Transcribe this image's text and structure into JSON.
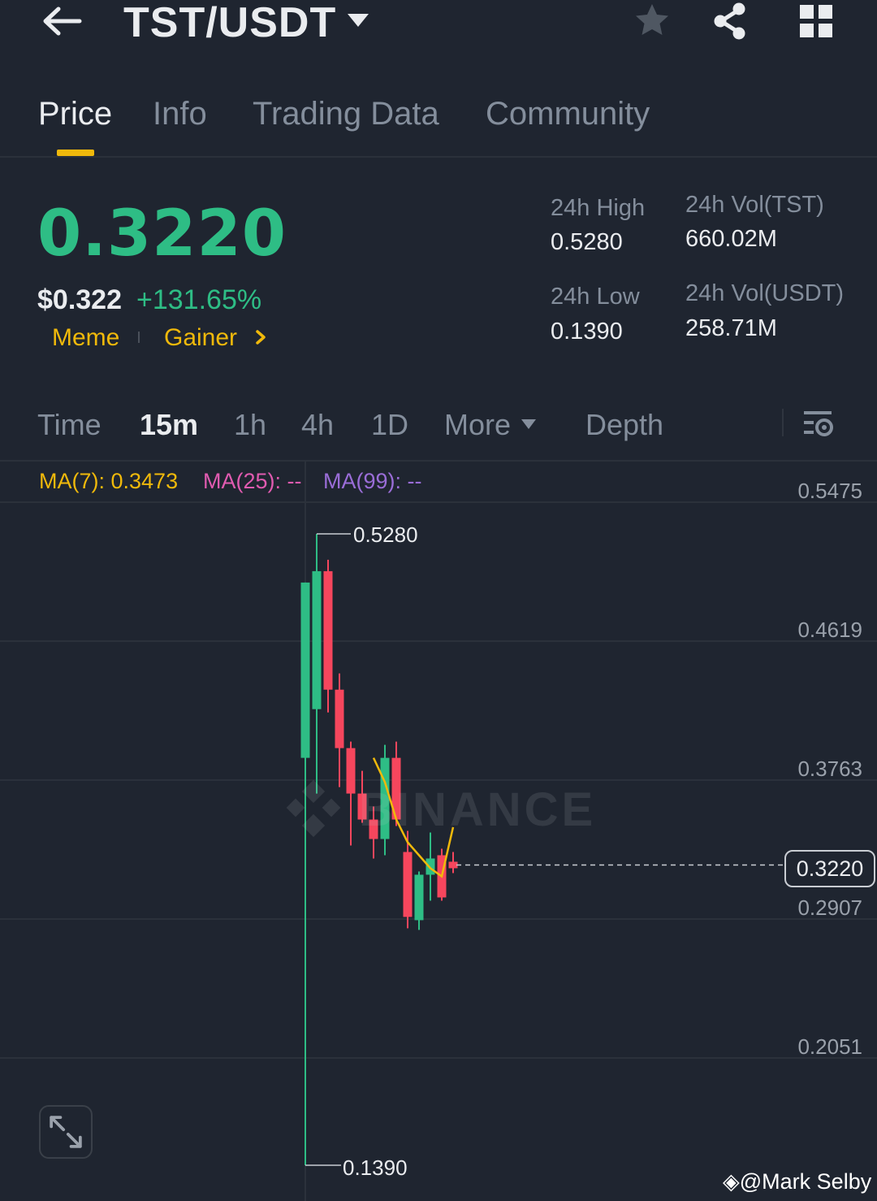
{
  "header": {
    "pair": "TST/USDT",
    "icons": [
      "back-arrow-icon",
      "caret-down-icon",
      "star-icon",
      "share-icon",
      "grid-icon"
    ]
  },
  "tabs": [
    {
      "label": "Price",
      "active": true
    },
    {
      "label": "Info",
      "active": false
    },
    {
      "label": "Trading Data",
      "active": false
    },
    {
      "label": "Community",
      "active": false
    }
  ],
  "ticker": {
    "last_price": "0.3220",
    "usd_price": "$0.322",
    "change_pct": "+131.65%",
    "tags": [
      "Meme",
      "Gainer"
    ],
    "stats": {
      "high_label": "24h High",
      "high_value": "0.5280",
      "low_label": "24h Low",
      "low_value": "0.1390",
      "vol_base_label": "24h Vol(TST)",
      "vol_base_value": "660.02M",
      "vol_quote_label": "24h Vol(USDT)",
      "vol_quote_value": "258.71M"
    }
  },
  "intervals": {
    "items": [
      {
        "label": "Time",
        "active": false
      },
      {
        "label": "15m",
        "active": true
      },
      {
        "label": "1h",
        "active": false
      },
      {
        "label": "4h",
        "active": false
      },
      {
        "label": "1D",
        "active": false
      },
      {
        "label": "More",
        "active": false
      },
      {
        "label": "Depth",
        "active": false
      }
    ]
  },
  "ma": {
    "ma7": "MA(7): 0.3473",
    "ma25": "MA(25): --",
    "ma99": "MA(99): --"
  },
  "colors": {
    "up": "#2ebd85",
    "down": "#f6465d",
    "accent": "#f0b90b",
    "ma7": "#f0b90b",
    "ma25": "#e05bb0",
    "ma99": "#9a6dd7",
    "bg": "#1f2530"
  },
  "chart_data": {
    "type": "candlestick",
    "y_ticks": [
      "0.5475",
      "0.4619",
      "0.3763",
      "0.2907",
      "0.2051"
    ],
    "ylim": [
      0.13,
      0.5475
    ],
    "current_price": "0.3220",
    "high_marker": "0.5280",
    "low_marker": "0.1390",
    "watermark": "BINANCE",
    "candles": [
      {
        "o": 0.39,
        "h": 0.498,
        "l": 0.139,
        "c": 0.498
      },
      {
        "o": 0.42,
        "h": 0.528,
        "l": 0.368,
        "c": 0.505
      },
      {
        "o": 0.505,
        "h": 0.512,
        "l": 0.418,
        "c": 0.432
      },
      {
        "o": 0.432,
        "h": 0.442,
        "l": 0.372,
        "c": 0.396
      },
      {
        "o": 0.396,
        "h": 0.4,
        "l": 0.336,
        "c": 0.368
      },
      {
        "o": 0.368,
        "h": 0.382,
        "l": 0.35,
        "c": 0.352
      },
      {
        "o": 0.352,
        "h": 0.36,
        "l": 0.328,
        "c": 0.34
      },
      {
        "o": 0.34,
        "h": 0.398,
        "l": 0.33,
        "c": 0.39
      },
      {
        "o": 0.39,
        "h": 0.4,
        "l": 0.348,
        "c": 0.352
      },
      {
        "o": 0.332,
        "h": 0.345,
        "l": 0.285,
        "c": 0.292
      },
      {
        "o": 0.29,
        "h": 0.32,
        "l": 0.284,
        "c": 0.318
      },
      {
        "o": 0.318,
        "h": 0.344,
        "l": 0.302,
        "c": 0.328
      },
      {
        "o": 0.33,
        "h": 0.334,
        "l": 0.302,
        "c": 0.304
      },
      {
        "o": 0.326,
        "h": 0.332,
        "l": 0.319,
        "c": 0.322
      }
    ],
    "ma7_values": [
      null,
      null,
      null,
      null,
      null,
      null,
      0.39,
      0.375,
      0.352,
      0.338,
      0.33,
      0.322,
      0.317,
      0.3473
    ]
  },
  "footer": {
    "credit": "@Mark Selby"
  }
}
